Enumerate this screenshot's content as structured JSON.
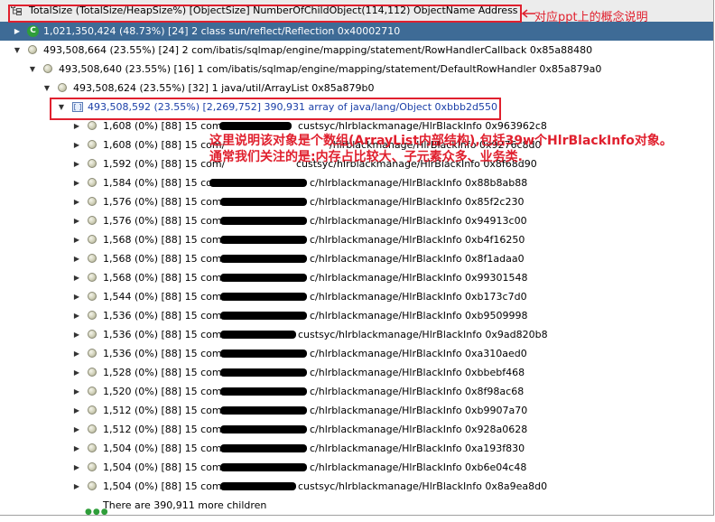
{
  "header": {
    "title": "TotalSize (TotalSize/HeapSize%) [ObjectSize] NumberOfChildObject(114,112) ObjectName Address"
  },
  "annotations": {
    "header_note": "对应ppt上的概念说明",
    "line1": "这里说明该对象是个数组(ArrayList内部结构),包括39w个HlrBlackInfo对象。",
    "line2": "通常我们关注的是:内存占比较大、子元素众多、业务类."
  },
  "rows": [
    {
      "text": "1,021,350,424 (48.73%) [24] 2 class sun/reflect/Reflection 0x40002710"
    },
    {
      "text": "493,508,664 (23.55%) [24] 2 com/ibatis/sqlmap/engine/mapping/statement/RowHandlerCallback 0x85a88480"
    },
    {
      "text": "493,508,640 (23.55%) [16] 1 com/ibatis/sqlmap/engine/mapping/statement/DefaultRowHandler 0x85a879a0"
    },
    {
      "text": "493,508,624 (23.55%) [32] 1 java/util/ArrayList 0x85a879b0"
    },
    {
      "text": "493,508,592 (23.55%) [2,269,752] 390,931 array of java/lang/Object 0xbbb2d550"
    }
  ],
  "children": [
    {
      "size": "1,608 (0%) [88] 15 com/",
      "tail": "custsyc/hlrblackmanage/HlrBlackInfo 0x963962c8"
    },
    {
      "size": "1,608 (0%) [88] 15 com/",
      "tail": "/hlrblackmanage/HlrBlackInfo 0x9276c8d0"
    },
    {
      "size": "1,592 (0%) [88] 15 com/",
      "tail": "custsyc/hlrblackmanage/HlrBlackInfo 0x8f68d90"
    },
    {
      "size": "1,584 (0%) [88] 15 com/",
      "tail": "c/hlrblackmanage/HlrBlackInfo 0x88b8ab88"
    },
    {
      "size": "1,576 (0%) [88] 15 com/",
      "tail": "c/hlrblackmanage/HlrBlackInfo 0x85f2c230"
    },
    {
      "size": "1,576 (0%) [88] 15 com/",
      "tail": "c/hlrblackmanage/HlrBlackInfo 0x94913c00"
    },
    {
      "size": "1,568 (0%) [88] 15 com/",
      "tail": "c/hlrblackmanage/HlrBlackInfo 0xb4f16250"
    },
    {
      "size": "1,568 (0%) [88] 15 com/",
      "tail": "c/hlrblackmanage/HlrBlackInfo 0x8f1adaa0"
    },
    {
      "size": "1,568 (0%) [88] 15 com/",
      "tail": "c/hlrblackmanage/HlrBlackInfo 0x99301548"
    },
    {
      "size": "1,544 (0%) [88] 15 com/",
      "tail": "c/hlrblackmanage/HlrBlackInfo 0xb173c7d0"
    },
    {
      "size": "1,536 (0%) [88] 15 com/",
      "tail": "c/hlrblackmanage/HlrBlackInfo 0xb9509998"
    },
    {
      "size": "1,536 (0%) [88] 15 com/",
      "tail": "custsyc/hlrblackmanage/HlrBlackInfo 0x9ad820b8"
    },
    {
      "size": "1,536 (0%) [88] 15 com/",
      "tail": "c/hlrblackmanage/HlrBlackInfo 0xa310aed0"
    },
    {
      "size": "1,528 (0%) [88] 15 com/",
      "tail": "c/hlrblackmanage/HlrBlackInfo 0xbbebf468"
    },
    {
      "size": "1,520 (0%) [88] 15 com/",
      "tail": "c/hlrblackmanage/HlrBlackInfo 0x8f98ac68"
    },
    {
      "size": "1,512 (0%) [88] 15 com/",
      "tail": "c/hlrblackmanage/HlrBlackInfo 0xb9907a70"
    },
    {
      "size": "1,512 (0%) [88] 15 com/",
      "tail": "c/hlrblackmanage/HlrBlackInfo 0x928a0628"
    },
    {
      "size": "1,504 (0%) [88] 15 com/",
      "tail": "c/hlrblackmanage/HlrBlackInfo 0xa193f830"
    },
    {
      "size": "1,504 (0%) [88] 15 com/",
      "tail": "c/hlrblackmanage/HlrBlackInfo 0xb6e04c48"
    },
    {
      "size": "1,504 (0%) [88] 15 com/",
      "tail": "custsyc/hlrblackmanage/HlrBlackInfo 0x8a9ea8d0"
    }
  ],
  "more": {
    "text": "There are 390,911 more children"
  }
}
